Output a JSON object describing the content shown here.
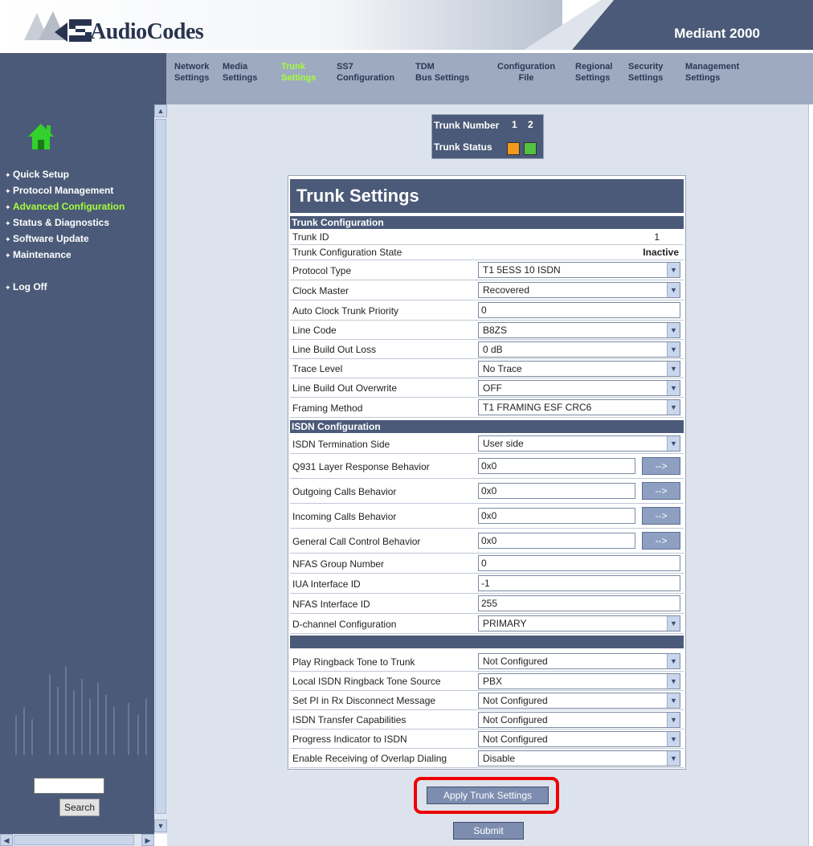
{
  "header": {
    "logo_text": "AudioCodes",
    "product": "Mediant 2000"
  },
  "nav": [
    {
      "line1": "Network",
      "line2": "Settings"
    },
    {
      "line1": "Media",
      "line2": "Settings"
    },
    {
      "line1": "Trunk",
      "line2": "Settings"
    },
    {
      "line1": "SS7",
      "line2": "Configuration"
    },
    {
      "line1": "TDM",
      "line2": "Bus Settings"
    },
    {
      "line1": "Configuration",
      "line2": "File"
    },
    {
      "line1": "Regional",
      "line2": "Settings"
    },
    {
      "line1": "Security",
      "line2": "Settings"
    },
    {
      "line1": "Management",
      "line2": "Settings"
    }
  ],
  "sidebar": {
    "items": [
      "Quick Setup",
      "Protocol Management",
      "Advanced Configuration",
      "Status & Diagnostics",
      "Software Update",
      "Maintenance"
    ],
    "logoff": "Log Off",
    "search_button": "Search"
  },
  "trunk_widget": {
    "number_label": "Trunk Number",
    "n1": "1",
    "n2": "2",
    "status_label": "Trunk Status",
    "status_colors": [
      "#f29a1c",
      "#52c341"
    ]
  },
  "panel": {
    "title": "Trunk Settings",
    "section1": "Trunk Configuration",
    "trunk_id_label": "Trunk ID",
    "trunk_id_value": "1",
    "state_label": "Trunk Configuration State",
    "state_value": "Inactive",
    "protocol_label": "Protocol Type",
    "protocol_value": "T1 5ESS 10 ISDN",
    "clock_master_label": "Clock Master",
    "clock_master_value": "Recovered",
    "auto_clock_label": "Auto Clock Trunk Priority",
    "auto_clock_value": "0",
    "line_code_label": "Line Code",
    "line_code_value": "B8ZS",
    "lbo_loss_label": "Line Build Out Loss",
    "lbo_loss_value": "0 dB",
    "trace_label": "Trace Level",
    "trace_value": "No Trace",
    "lbo_overwrite_label": "Line Build Out Overwrite",
    "lbo_overwrite_value": "OFF",
    "framing_label": "Framing Method",
    "framing_value": "T1 FRAMING ESF CRC6",
    "section2": "ISDN Configuration",
    "term_side_label": "ISDN Termination Side",
    "term_side_value": "User side",
    "q931_label": "Q931 Layer Response Behavior",
    "q931_value": "0x0",
    "outgoing_label": "Outgoing Calls Behavior",
    "outgoing_value": "0x0",
    "incoming_label": "Incoming Calls Behavior",
    "incoming_value": "0x0",
    "general_label": "General Call Control Behavior",
    "general_value": "0x0",
    "arrow_btn": "-->",
    "nfas_group_label": "NFAS Group Number",
    "nfas_group_value": "0",
    "iua_label": "IUA Interface ID",
    "iua_value": "-1",
    "nfas_if_label": "NFAS Interface ID",
    "nfas_if_value": "255",
    "dchannel_label": "D-channel Configuration",
    "dchannel_value": "PRIMARY",
    "ringback_label": "Play Ringback Tone to Trunk",
    "ringback_value": "Not Configured",
    "local_ringback_label": "Local ISDN Ringback Tone Source",
    "local_ringback_value": "PBX",
    "set_pi_label": "Set PI in Rx Disconnect Message",
    "set_pi_value": "Not Configured",
    "transfer_label": "ISDN Transfer Capabilities",
    "transfer_value": "Not Configured",
    "progress_label": "Progress Indicator to ISDN",
    "progress_value": "Not Configured",
    "overlap_label": "Enable Receiving of Overlap Dialing",
    "overlap_value": "Disable"
  },
  "buttons": {
    "apply": "Apply Trunk Settings",
    "submit": "Submit"
  }
}
